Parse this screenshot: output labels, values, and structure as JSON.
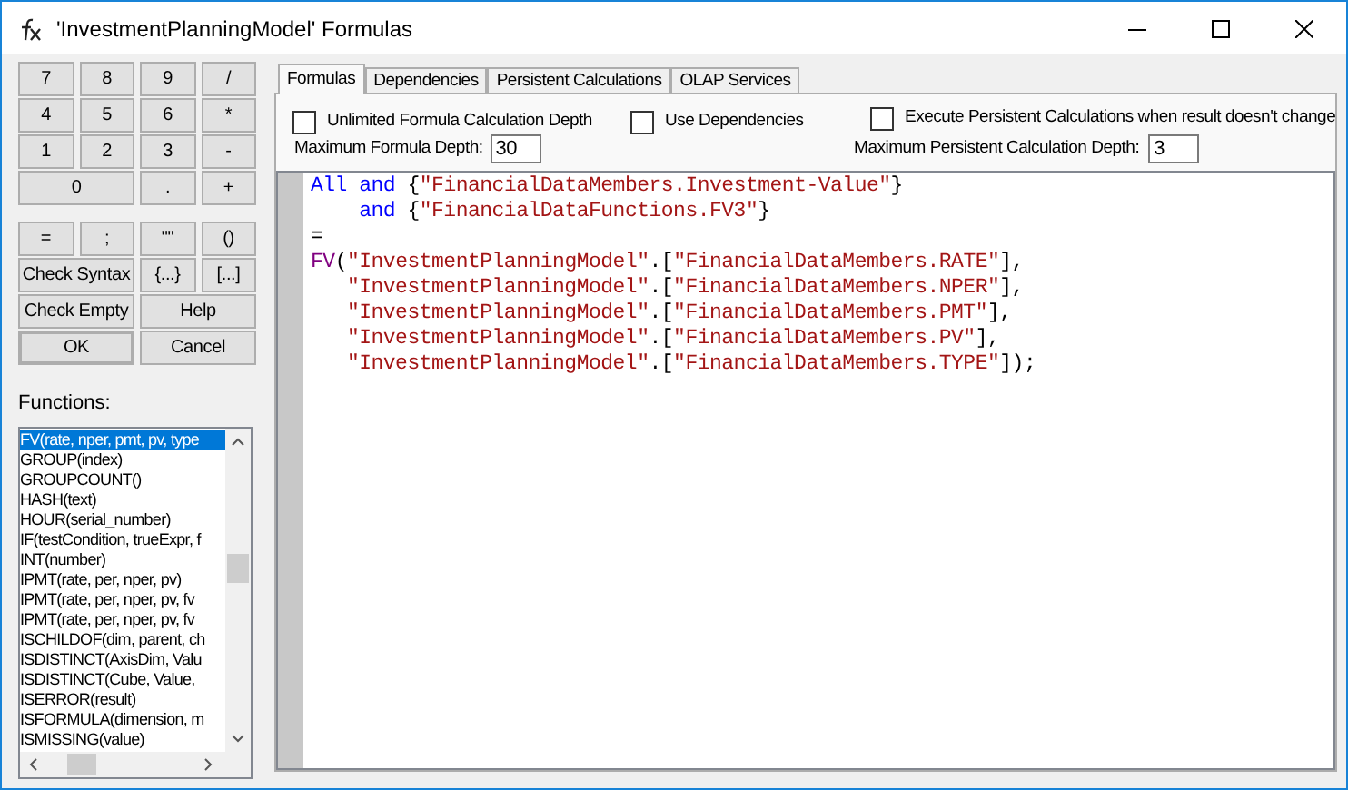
{
  "window": {
    "title": "'InvestmentPlanningModel' Formulas"
  },
  "keypad_groups": [
    [
      {
        "label": "7",
        "kind": "key"
      },
      {
        "label": "8",
        "kind": "key"
      },
      {
        "label": "9",
        "kind": "key"
      },
      {
        "label": "/",
        "kind": "key"
      },
      {
        "label": "4",
        "kind": "key"
      },
      {
        "label": "5",
        "kind": "key"
      },
      {
        "label": "6",
        "kind": "key"
      },
      {
        "label": "*",
        "kind": "key"
      },
      {
        "label": "1",
        "kind": "key"
      },
      {
        "label": "2",
        "kind": "key"
      },
      {
        "label": "3",
        "kind": "key"
      },
      {
        "label": "-",
        "kind": "key"
      },
      {
        "label": "0",
        "kind": "wide"
      },
      {
        "label": ".",
        "kind": "key"
      },
      {
        "label": "+",
        "kind": "key"
      }
    ],
    [
      {
        "label": "=",
        "kind": "key"
      },
      {
        "label": ";",
        "kind": "key"
      },
      {
        "label": "\"\"",
        "kind": "key"
      },
      {
        "label": "()",
        "kind": "key"
      },
      {
        "label": "Check Syntax",
        "kind": "wide"
      },
      {
        "label": "{...}",
        "kind": "key"
      },
      {
        "label": "[...]",
        "kind": "key"
      },
      {
        "label": "Check Empty",
        "kind": "wide"
      },
      {
        "label": "Help",
        "kind": "wide"
      },
      {
        "label": "OK",
        "kind": "default"
      },
      {
        "label": "Cancel",
        "kind": "wide"
      }
    ]
  ],
  "functions": {
    "label": "Functions:",
    "items": [
      {
        "text": "FV(rate, nper, pmt, pv, type",
        "selected": true
      },
      {
        "text": "GROUP(index)",
        "selected": false
      },
      {
        "text": "GROUPCOUNT()",
        "selected": false
      },
      {
        "text": "HASH(text)",
        "selected": false
      },
      {
        "text": "HOUR(serial_number)",
        "selected": false
      },
      {
        "text": "IF(testCondition, trueExpr, f",
        "selected": false
      },
      {
        "text": "INT(number)",
        "selected": false
      },
      {
        "text": "IPMT(rate, per, nper, pv)",
        "selected": false
      },
      {
        "text": "IPMT(rate, per, nper, pv, fv",
        "selected": false
      },
      {
        "text": "IPMT(rate, per, nper, pv, fv",
        "selected": false
      },
      {
        "text": "ISCHILDOF(dim, parent, ch",
        "selected": false
      },
      {
        "text": "ISDISTINCT(AxisDim, Valu",
        "selected": false
      },
      {
        "text": "ISDISTINCT(Cube, Value, ",
        "selected": false
      },
      {
        "text": "ISERROR(result)",
        "selected": false
      },
      {
        "text": "ISFORMULA(dimension, m",
        "selected": false
      },
      {
        "text": "ISMISSING(value)",
        "selected": false
      }
    ]
  },
  "tabs": [
    {
      "label": "Formulas",
      "selected": true
    },
    {
      "label": "Dependencies",
      "selected": false
    },
    {
      "label": "Persistent Calculations",
      "selected": false
    },
    {
      "label": "OLAP Services",
      "selected": false
    }
  ],
  "options": [
    {
      "label": "Unlimited Formula Calculation Depth",
      "checked": false
    },
    {
      "label": "Use Dependencies",
      "checked": false
    },
    {
      "label": "Execute Persistent Calculations when result doesn't change",
      "checked": false
    }
  ],
  "depth_fields": [
    {
      "label": "Maximum Formula Depth:",
      "value": "30"
    },
    {
      "label": "Maximum Persistent Calculation Depth:",
      "value": "3"
    }
  ],
  "editor": {
    "lines": [
      [
        {
          "kind": "keyword",
          "text": "All"
        },
        {
          "kind": "keyword",
          "text": " and"
        },
        {
          "kind": "plain",
          "text": " {"
        },
        {
          "kind": "string",
          "text": "\"FinancialDataMembers.Investment-Value\""
        },
        {
          "kind": "plain",
          "text": "}"
        }
      ],
      [
        {
          "kind": "keyword",
          "text": "    and"
        },
        {
          "kind": "plain",
          "text": " {"
        },
        {
          "kind": "string",
          "text": "\"FinancialDataFunctions.FV3\""
        },
        {
          "kind": "plain",
          "text": "}"
        }
      ],
      [
        {
          "kind": "plain",
          "text": "="
        }
      ],
      [
        {
          "kind": "function",
          "text": "FV"
        },
        {
          "kind": "plain",
          "text": "("
        },
        {
          "kind": "string",
          "text": "\"InvestmentPlanningModel\""
        },
        {
          "kind": "plain",
          "text": ".["
        },
        {
          "kind": "string",
          "text": "\"FinancialDataMembers.RATE\""
        },
        {
          "kind": "plain",
          "text": "],"
        }
      ],
      [
        {
          "kind": "string",
          "text": "   \"InvestmentPlanningModel\""
        },
        {
          "kind": "plain",
          "text": ".["
        },
        {
          "kind": "string",
          "text": "\"FinancialDataMembers.NPER\""
        },
        {
          "kind": "plain",
          "text": "],"
        }
      ],
      [
        {
          "kind": "string",
          "text": "   \"InvestmentPlanningModel\""
        },
        {
          "kind": "plain",
          "text": ".["
        },
        {
          "kind": "string",
          "text": "\"FinancialDataMembers.PMT\""
        },
        {
          "kind": "plain",
          "text": "],"
        }
      ],
      [
        {
          "kind": "string",
          "text": "   \"InvestmentPlanningModel\""
        },
        {
          "kind": "plain",
          "text": ".["
        },
        {
          "kind": "string",
          "text": "\"FinancialDataMembers.PV\""
        },
        {
          "kind": "plain",
          "text": "],"
        }
      ],
      [
        {
          "kind": "string",
          "text": "   \"InvestmentPlanningModel\""
        },
        {
          "kind": "plain",
          "text": ".["
        },
        {
          "kind": "string",
          "text": "\"FinancialDataMembers.TYPE\""
        },
        {
          "kind": "plain",
          "text": "]);"
        }
      ]
    ]
  }
}
